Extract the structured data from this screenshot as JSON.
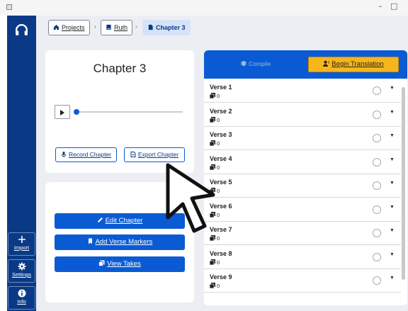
{
  "window": {
    "minimize": "–",
    "maximize": "□"
  },
  "sidebar": {
    "items": [
      {
        "label": "Import"
      },
      {
        "label": "Settings"
      },
      {
        "label": "Info"
      }
    ]
  },
  "breadcrumb": {
    "items": [
      {
        "label": "Projects"
      },
      {
        "label": "Ruth"
      },
      {
        "label": "Chapter 3"
      }
    ]
  },
  "chapter_card": {
    "title": "Chapter 3",
    "playback_progress": 0,
    "record_label": "Record Chapter",
    "export_label": "Export Chapter"
  },
  "actions": {
    "edit_label": "Edit Chapter",
    "markers_label": "Add Verse Markers",
    "takes_label": "View Takes"
  },
  "verses": {
    "compile_label": "Compile",
    "begin_label": "Begin Translation",
    "accent_color": "#f6b51b",
    "items": [
      {
        "name": "Verse 1",
        "count": "0"
      },
      {
        "name": "Verse 2",
        "count": "0"
      },
      {
        "name": "Verse 3",
        "count": "0"
      },
      {
        "name": "Verse 4",
        "count": "0"
      },
      {
        "name": "Verse 5",
        "count": "0"
      },
      {
        "name": "Verse 6",
        "count": "0"
      },
      {
        "name": "Verse 7",
        "count": "0"
      },
      {
        "name": "Verse 8",
        "count": "0"
      },
      {
        "name": "Verse 9",
        "count": "0"
      }
    ]
  },
  "colors": {
    "primary": "#0a5bd3",
    "sidebar": "#0a3a86"
  }
}
